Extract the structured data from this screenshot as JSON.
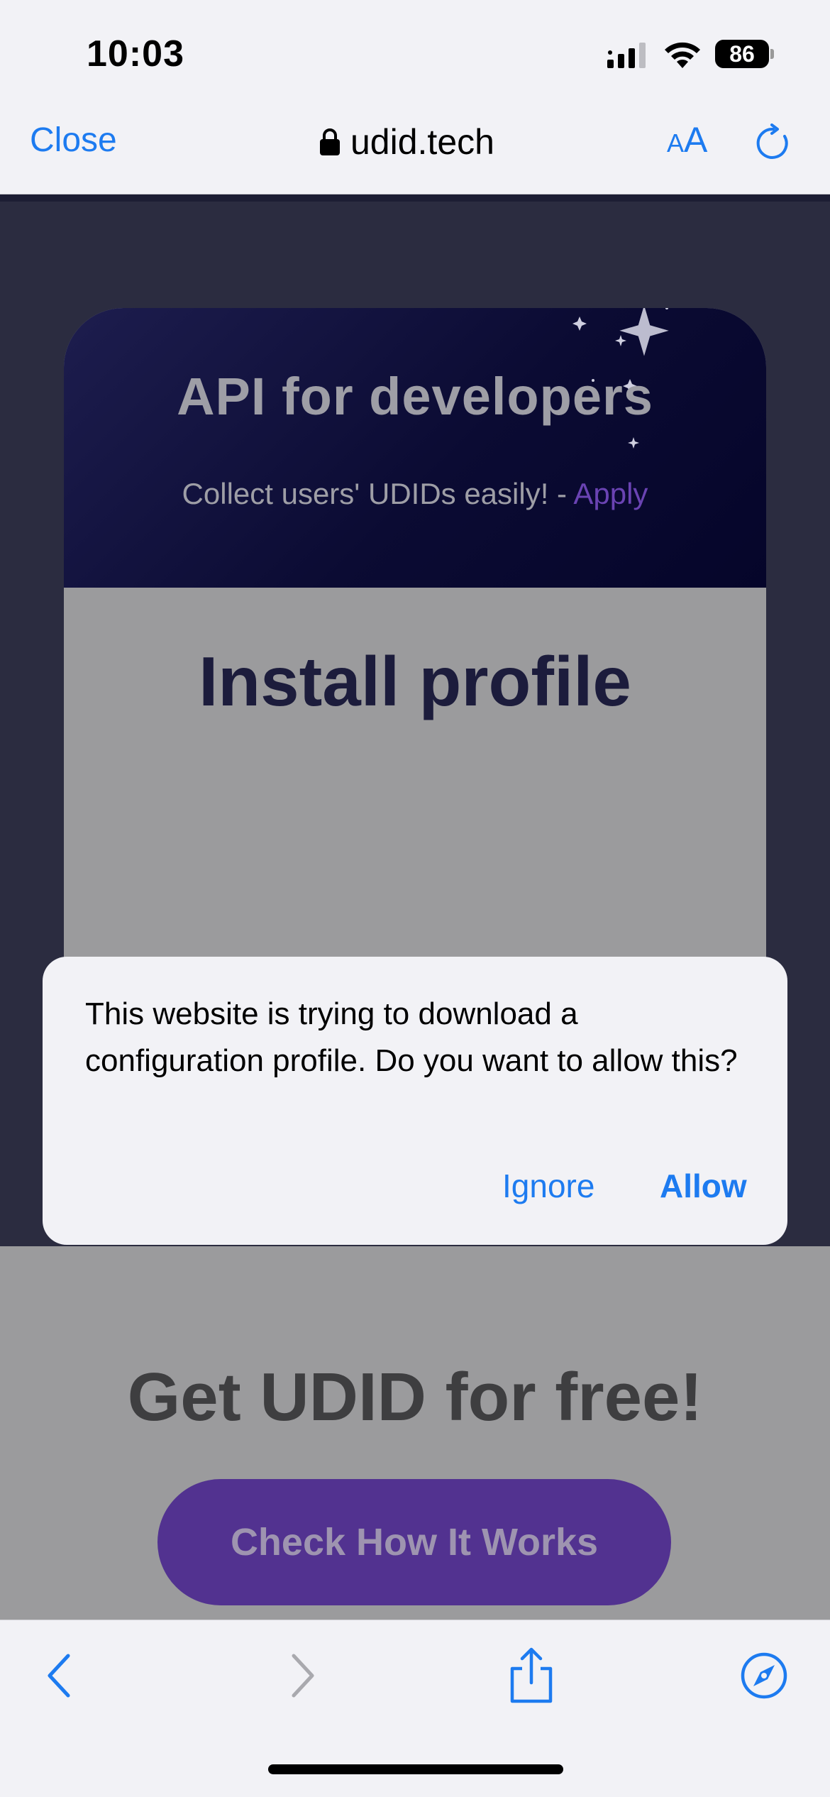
{
  "status_bar": {
    "time": "10:03",
    "battery": "86"
  },
  "browser": {
    "close_label": "Close",
    "url": "udid.tech",
    "text_size_small": "A",
    "text_size_large": "A"
  },
  "page": {
    "card": {
      "title": "API for developers",
      "subtitle": "Collect users' UDIDs easily! - ",
      "apply_link": "Apply",
      "install_title": "Install profile"
    },
    "free_title": "Get UDID for free!",
    "check_button": "Check How It Works"
  },
  "dialog": {
    "message": "This website is trying to download a configuration profile. Do you want to allow this?",
    "ignore_label": "Ignore",
    "allow_label": "Allow"
  },
  "colors": {
    "accent": "#1d7bf0",
    "page_dark": "#2b2c40",
    "purple": "#523290"
  }
}
